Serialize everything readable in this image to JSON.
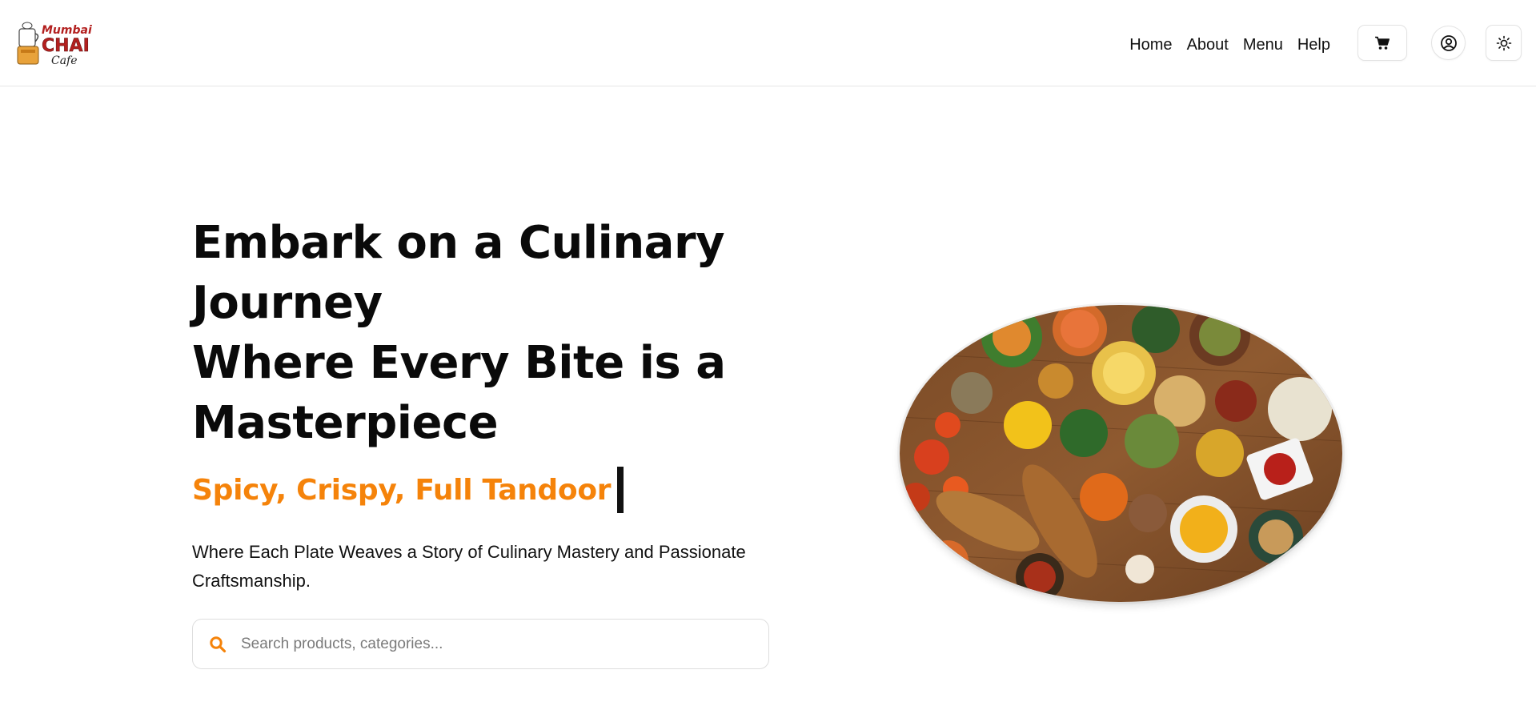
{
  "brand": {
    "logo_line1": "Mumbai",
    "logo_line2": "CHAI",
    "logo_line3": "Cafe"
  },
  "nav": {
    "items": [
      {
        "label": "Home"
      },
      {
        "label": "About"
      },
      {
        "label": "Menu"
      },
      {
        "label": "Help"
      }
    ]
  },
  "header_icons": {
    "cart": "shopping-cart-icon",
    "user": "user-circle-icon",
    "theme": "sun-icon"
  },
  "hero": {
    "title_line1": "Embark on a Culinary",
    "title_line2": "Journey",
    "title_line3": "Where Every Bite is a",
    "title_line4": "Masterpiece",
    "typed_text": "Spicy, Crispy, Full Tandoor",
    "subtitle_line1": "Where Each Plate Weaves a Story of Culinary Mastery and Passionate",
    "subtitle_line2": "Craftsmanship.",
    "image": "food-spread-photo"
  },
  "search": {
    "placeholder": "Search products, categories...",
    "value": "",
    "icon": "search-icon"
  },
  "colors": {
    "accent": "#f5830a",
    "text": "#111111",
    "border": "#e3e3e3",
    "logo_red": "#b3201f"
  }
}
